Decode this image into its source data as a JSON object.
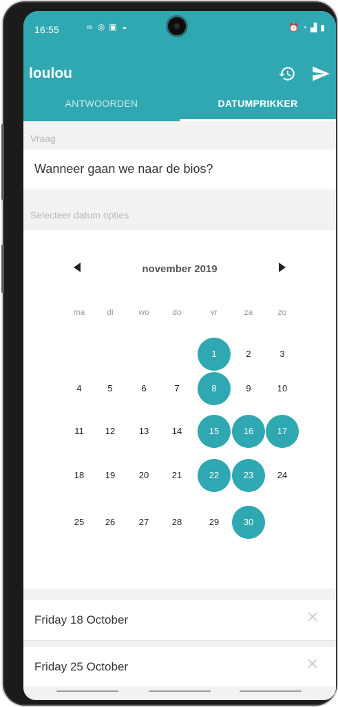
{
  "status_bar": {
    "time": "16:55"
  },
  "app_bar": {
    "title": "loulou",
    "history_icon": "history-icon",
    "send_icon": "send-icon"
  },
  "tabs": [
    {
      "label": "ANTWOORDEN",
      "active": false
    },
    {
      "label": "DATUMPRIKKER",
      "active": true
    }
  ],
  "question": {
    "section_label": "Vraag",
    "text": "Wanneer gaan we naar de bios?"
  },
  "calendar": {
    "section_label": "Selecteer datum opties",
    "month_label": "november 2019",
    "weekdays": [
      "ma",
      "di",
      "wo",
      "do",
      "vr",
      "za",
      "zo"
    ],
    "days": [
      "1",
      "2",
      "3",
      "4",
      "5",
      "6",
      "7",
      "8",
      "9",
      "10",
      "11",
      "12",
      "13",
      "14",
      "15",
      "16",
      "17",
      "18",
      "19",
      "20",
      "21",
      "22",
      "23",
      "24",
      "25",
      "26",
      "27",
      "28",
      "29",
      "30"
    ],
    "selected_days": [
      1,
      8,
      15,
      16,
      17,
      22,
      23,
      30
    ]
  },
  "selected_dates": [
    {
      "label": "Friday 18 October"
    },
    {
      "label": "Friday 25 October"
    }
  ],
  "colors": {
    "accent": "#30a8b1"
  }
}
